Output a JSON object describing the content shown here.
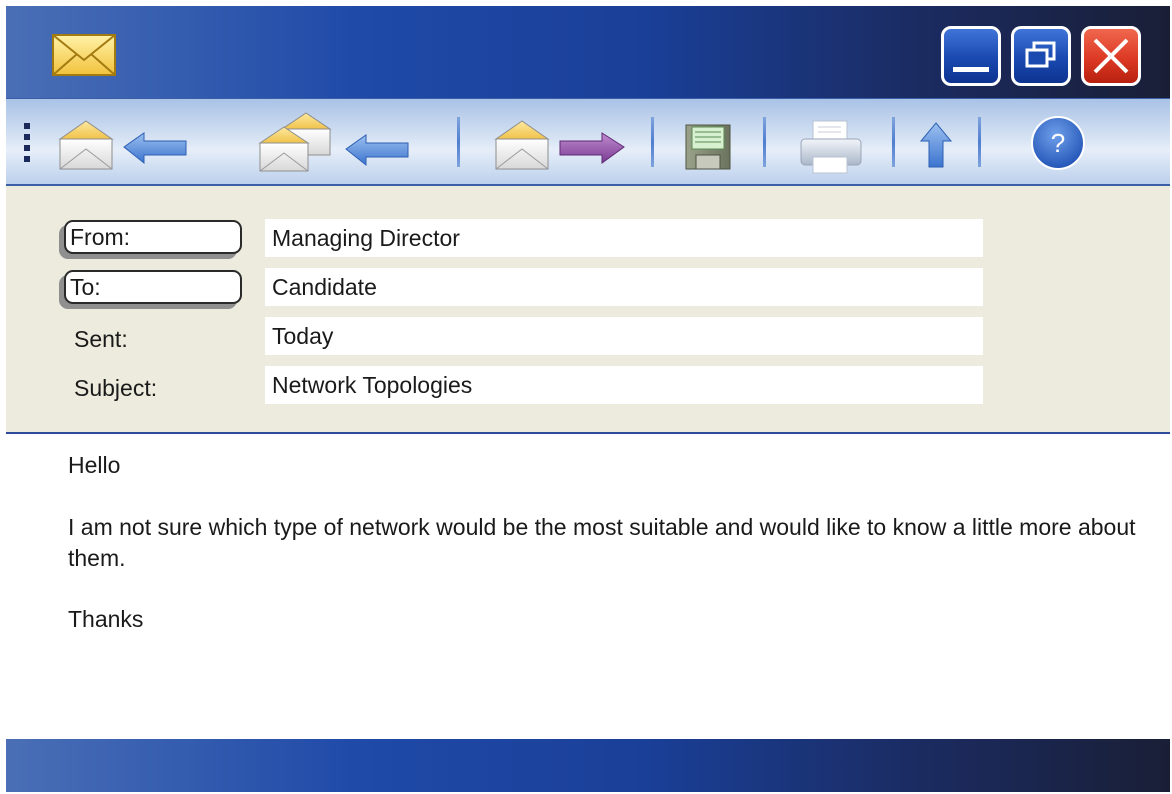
{
  "window": {
    "title_icon": "envelope-icon",
    "controls": [
      {
        "name": "minimize",
        "icon": "minimize-icon"
      },
      {
        "name": "maximize",
        "icon": "restore-icon"
      },
      {
        "name": "close",
        "icon": "close-icon"
      }
    ]
  },
  "toolbar": {
    "items": [
      {
        "name": "reply",
        "icon": "reply-icon"
      },
      {
        "name": "reply-all",
        "icon": "reply-all-icon"
      },
      {
        "name": "forward",
        "icon": "forward-icon"
      },
      {
        "name": "save",
        "icon": "save-icon"
      },
      {
        "name": "print",
        "icon": "print-icon"
      },
      {
        "name": "upload",
        "icon": "up-arrow-icon"
      },
      {
        "name": "help",
        "icon": "help-icon",
        "label": "?"
      }
    ]
  },
  "header": {
    "from_label": "From:",
    "from_value": "Managing Director",
    "to_label": "To:",
    "to_value": "Candidate",
    "sent_label": "Sent:",
    "sent_value": "Today",
    "subject_label": "Subject:",
    "subject_value": "Network Topologies"
  },
  "message": {
    "greeting": "Hello",
    "body": "I am not sure which type of network would be the most suitable and would like to know a little more about them.",
    "closing": "Thanks"
  },
  "colors": {
    "title_gradient_start": "#4a6fb6",
    "title_gradient_end": "#1a1f36",
    "header_bg": "#ecebdd",
    "close_red": "#dc3a24",
    "accent_blue": "#3f74d8",
    "forward_purple": "#8a4ca0"
  }
}
